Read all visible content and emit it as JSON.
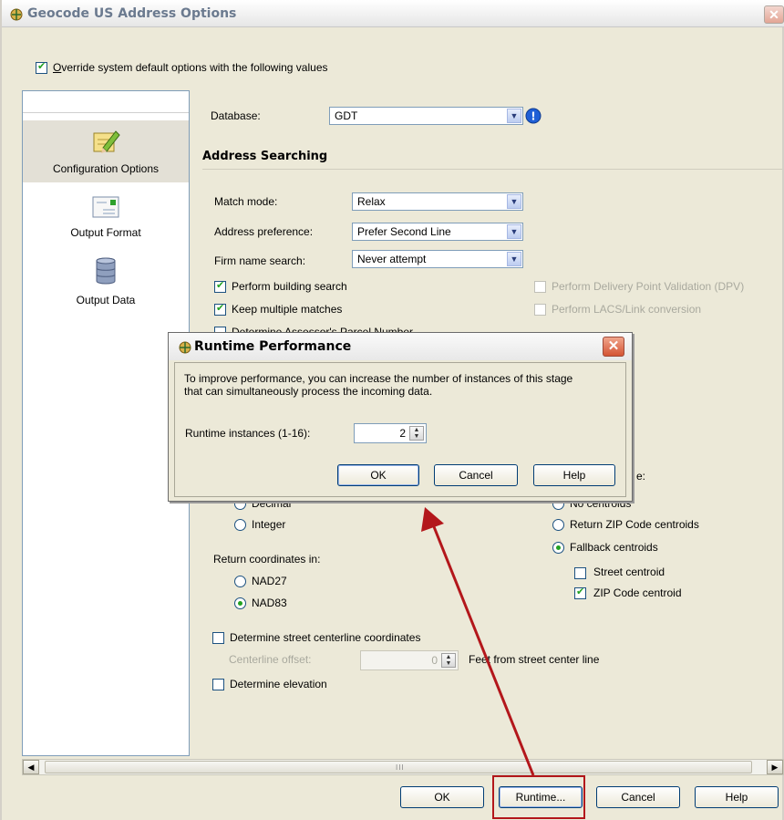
{
  "window": {
    "title": "Geocode US Address Options",
    "close_glyph": "✕"
  },
  "override": {
    "label_underlined": "O",
    "label_rest": "verride system default options with the following values",
    "checked": true
  },
  "nav": {
    "items": [
      {
        "label": "Configuration Options",
        "icon": "pencil-note-icon",
        "selected": true
      },
      {
        "label": "Output Format",
        "icon": "document-icon",
        "selected": false
      },
      {
        "label": "Output Data",
        "icon": "database-icon",
        "selected": false
      }
    ]
  },
  "database": {
    "label": "Database:",
    "value": "GDT"
  },
  "address_searching": {
    "title": "Address Searching",
    "match_mode": {
      "label": "Match mode:",
      "value": "Relax"
    },
    "address_preference": {
      "label": "Address preference:",
      "value": "Prefer Second Line"
    },
    "firm_name_search": {
      "label": "Firm name search:",
      "value": "Never attempt"
    },
    "perform_building_search": {
      "label": "Perform building search",
      "checked": true
    },
    "keep_multiple_matches": {
      "label": "Keep multiple matches",
      "checked": true
    },
    "apn_partial": {
      "label": "Determine Assessor's Parcel Number"
    },
    "dpv": {
      "label": "Perform Delivery Point Validation (DPV)",
      "checked": false
    },
    "lacs": {
      "label": "Perform LACS/Link conversion",
      "checked": false
    }
  },
  "coordinates": {
    "format_decimal_partial": "Decimal",
    "format_integer": "Integer",
    "return_in_label": "Return coordinates in:",
    "nad27": "NAD27",
    "nad83": "NAD83",
    "nad83_selected": true,
    "street_centerline": {
      "label": "Determine street centerline coordinates",
      "checked": false
    },
    "centerline_offset_label": "Centerline offset:",
    "centerline_offset_value": "0",
    "centerline_offset_unit": "Feet from street center line",
    "elevation": {
      "label": "Determine elevation",
      "checked": false
    }
  },
  "centroids": {
    "header_partial": "e:",
    "no_centroids_partial": "No centroids",
    "zip_centroids": "Return ZIP Code centroids",
    "fallback": "Fallback centroids",
    "fallback_selected": true,
    "street_centroid": {
      "label": "Street centroid",
      "checked": false
    },
    "zip_code_centroid": {
      "label": "ZIP Code centroid",
      "checked": true
    }
  },
  "footer": {
    "ok": "OK",
    "runtime": "Runtime...",
    "cancel": "Cancel",
    "help": "Help"
  },
  "runtime_dialog": {
    "title": "Runtime Performance",
    "description_line1": "To improve performance, you can increase the number of instances of this stage",
    "description_line2": "that can simultaneously process the incoming data.",
    "instances_label": "Runtime instances (1-16):",
    "instances_value": "2",
    "ok": "OK",
    "cancel": "Cancel",
    "help": "Help"
  },
  "scrollbar": {
    "grip": "III"
  },
  "colors": {
    "annotation_red": "#b3171b",
    "check_green": "#21a121",
    "info_blue": "#1f5fd6"
  }
}
